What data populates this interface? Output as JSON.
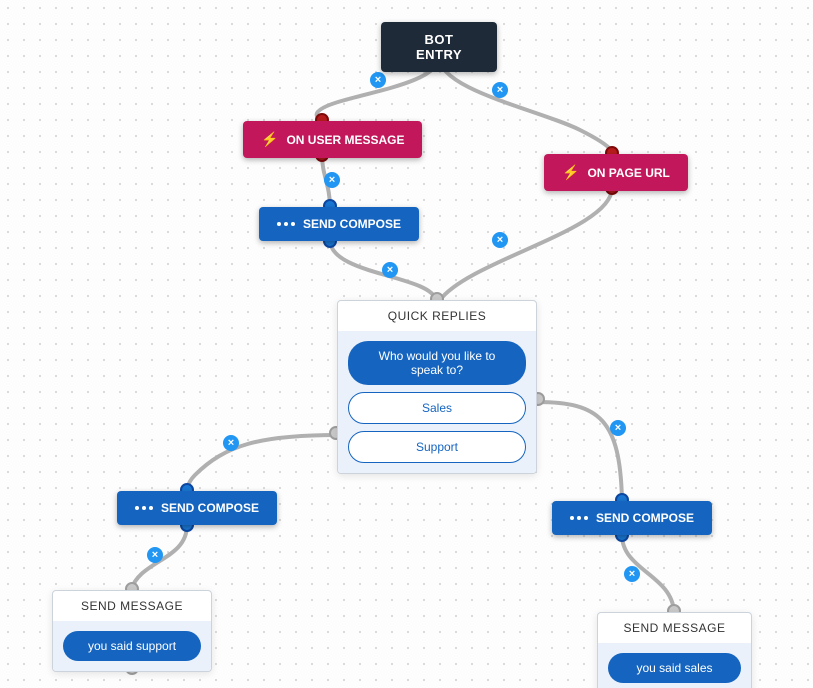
{
  "nodes": {
    "entry": {
      "label": "BOT ENTRY"
    },
    "onUserMsg": {
      "label": "ON USER MESSAGE"
    },
    "onPageUrl": {
      "label": "ON PAGE URL"
    },
    "compose1": {
      "label": "SEND COMPOSE"
    },
    "compose2": {
      "label": "SEND COMPOSE"
    },
    "compose3": {
      "label": "SEND COMPOSE"
    },
    "quick": {
      "title": "QUICK REPLIES",
      "prompt": "Who would you like to speak to?",
      "option1": "Sales",
      "option2": "Support"
    },
    "msgSupport": {
      "title": "SEND MESSAGE",
      "text": "you said support"
    },
    "msgSales": {
      "title": "SEND MESSAGE",
      "text": "you said sales"
    }
  }
}
